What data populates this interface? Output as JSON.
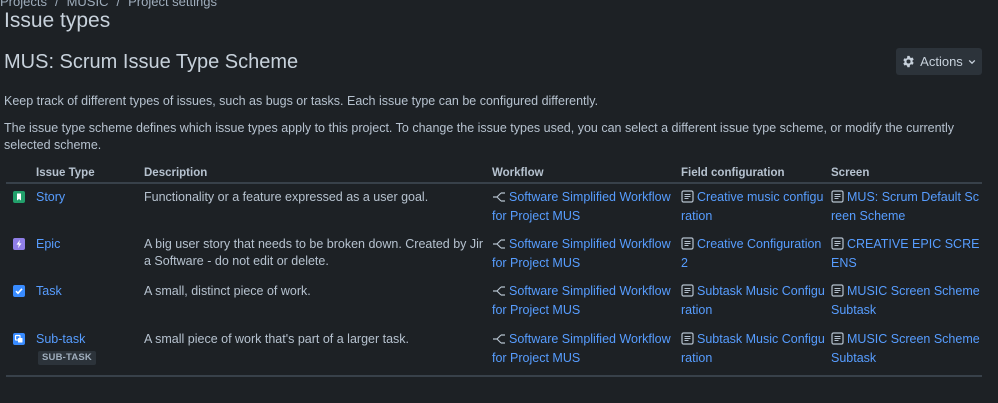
{
  "breadcrumbs": [
    "Projects",
    "MUSIC",
    "Project settings"
  ],
  "page_title": "Issue types",
  "scheme_title": "MUS: Scrum Issue Type Scheme",
  "actions_label": "Actions",
  "intro_text": "Keep track of different types of issues, such as bugs or tasks. Each issue type can be configured differently.",
  "scheme_text": "The issue type scheme defines which issue types apply to this project. To change the issue types used, you can select a different issue type scheme, or modify the currently selected scheme.",
  "columns": [
    "Issue Type",
    "Description",
    "Workflow",
    "Field configuration",
    "Screen"
  ],
  "rows": [
    {
      "icon": "story-icon",
      "icon_color": "#22a06b",
      "name": "Story",
      "lozenge": "",
      "description": "Functionality or a feature expressed as a user goal.",
      "workflow": "Software Simplified Workflow for Project MUS",
      "field_config": "Creative music configuration",
      "screen": "MUS: Scrum Default Screen Scheme"
    },
    {
      "icon": "epic-icon",
      "icon_color": "#8f7ee7",
      "name": "Epic",
      "lozenge": "",
      "description": "A big user story that needs to be broken down. Created by Jira Software - do not edit or delete.",
      "workflow": "Software Simplified Workflow for Project MUS",
      "field_config": "Creative Configuration 2",
      "screen": "CREATIVE EPIC SCREENS"
    },
    {
      "icon": "task-icon",
      "icon_color": "#388bff",
      "name": "Task",
      "lozenge": "",
      "description": "A small, distinct piece of work.",
      "workflow": "Software Simplified Workflow for Project MUS",
      "field_config": "Subtask Music Configuration",
      "screen": "MUSIC Screen Scheme Subtask"
    },
    {
      "icon": "subtask-icon",
      "icon_color": "#388bff",
      "name": "Sub-task",
      "lozenge": "SUB-TASK",
      "description": "A small piece of work that's part of a larger task.",
      "workflow": "Software Simplified Workflow for Project MUS",
      "field_config": "Subtask Music Configuration",
      "screen": "MUSIC Screen Scheme Subtask"
    }
  ]
}
